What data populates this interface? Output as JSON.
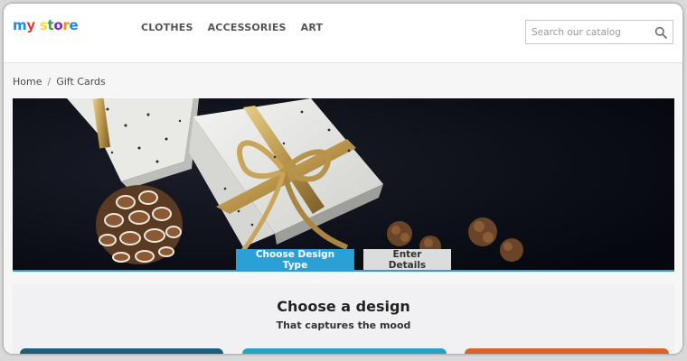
{
  "logo": {
    "text": "my store",
    "colors": [
      "#1e88e5",
      "#e53935",
      "#fdd835",
      "#43a047",
      "#8e24aa",
      "#fb8c00",
      "#1e88e5",
      "#e53935"
    ]
  },
  "nav": {
    "items": [
      "CLOTHES",
      "ACCESSORIES",
      "ART"
    ]
  },
  "search": {
    "placeholder": "Search our catalog"
  },
  "breadcrumb": {
    "items": [
      "Home",
      "Gift Cards"
    ],
    "separator": "/"
  },
  "steps": {
    "active_label": "Choose Design Type",
    "inactive_label": "Enter Details"
  },
  "design": {
    "title": "Choose a design",
    "subtitle": "That captures the mood"
  },
  "colors": {
    "accent": "#2aa0d6",
    "card1": "#1d5f7a",
    "card2": "#25a3c7",
    "card3": "#d9642a"
  }
}
